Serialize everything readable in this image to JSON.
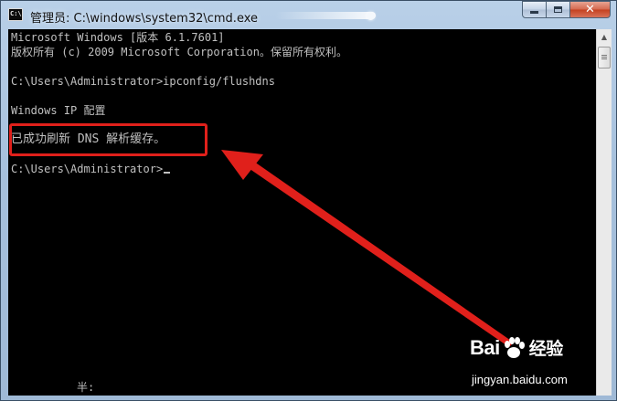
{
  "window": {
    "title": "管理员: C:\\windows\\system32\\cmd.exe",
    "app_icon_text": "C:\\"
  },
  "console": {
    "lines": [
      "Microsoft Windows [版本 6.1.7601]",
      "版权所有 (c) 2009 Microsoft Corporation。保留所有权利。",
      "",
      "C:\\Users\\Administrator>ipconfig/flushdns",
      "",
      "Windows IP 配置",
      "",
      "已成功刷新 DNS 解析缓存。",
      "",
      "C:\\Users\\Administrator>"
    ],
    "ime_status": "半:"
  },
  "annotation": {
    "color": "#e0201b"
  },
  "watermark": {
    "brand": "Bai",
    "brand_suffix": "经验",
    "url": "jingyan.baidu.com"
  },
  "colors": {
    "console_bg": "#000000",
    "console_fg": "#c0c0c0",
    "close_button": "#c4401f"
  }
}
